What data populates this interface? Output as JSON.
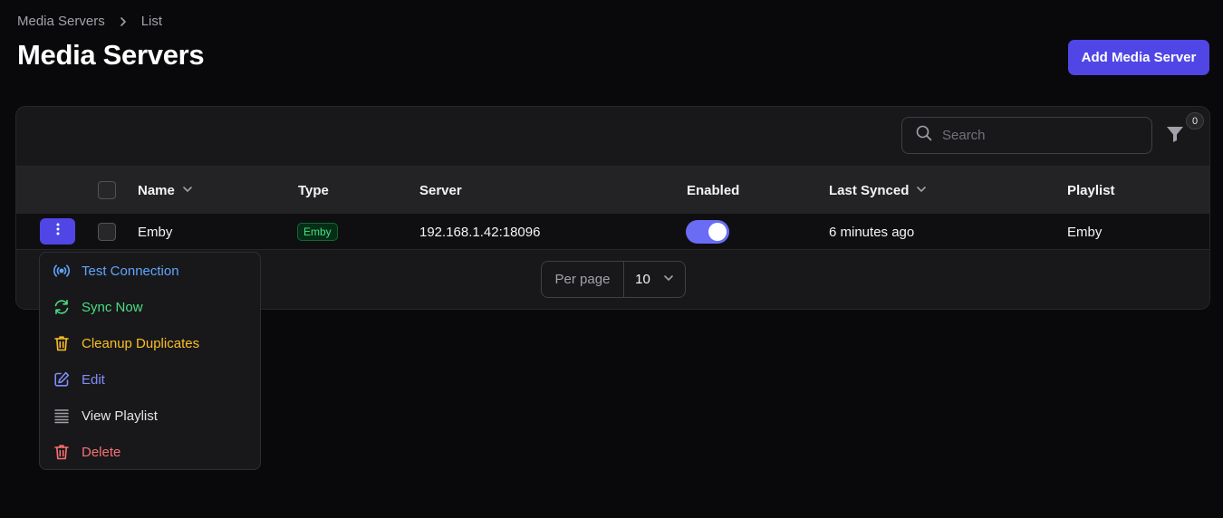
{
  "breadcrumb": {
    "items": [
      "Media Servers",
      "List"
    ]
  },
  "header": {
    "title": "Media Servers",
    "add_button": "Add Media Server"
  },
  "toolbar": {
    "search_placeholder": "Search",
    "filter_count": "0"
  },
  "table": {
    "columns": {
      "name": "Name",
      "type": "Type",
      "server": "Server",
      "enabled": "Enabled",
      "last_synced": "Last Synced",
      "playlist": "Playlist"
    },
    "rows": [
      {
        "name": "Emby",
        "type": "Emby",
        "server": "192.168.1.42:18096",
        "enabled": true,
        "last_synced": "6 minutes ago",
        "playlist": "Emby"
      }
    ]
  },
  "pagination": {
    "label": "Per page",
    "value": "10"
  },
  "actions_menu": {
    "items": [
      {
        "label": "Test Connection",
        "icon": "signal-icon",
        "color": "#60a5fa"
      },
      {
        "label": "Sync Now",
        "icon": "refresh-icon",
        "color": "#4ade80"
      },
      {
        "label": "Cleanup Duplicates",
        "icon": "trash-icon",
        "color": "#fbbf24"
      },
      {
        "label": "Edit",
        "icon": "pencil-square-icon",
        "color": "#818cf8"
      },
      {
        "label": "View Playlist",
        "icon": "list-icon",
        "color": "#e4e4e7"
      },
      {
        "label": "Delete",
        "icon": "trash-icon",
        "color": "#f87171"
      }
    ]
  },
  "colors": {
    "accent": "#5046e5",
    "background": "#09090b",
    "surface": "#18181b"
  }
}
